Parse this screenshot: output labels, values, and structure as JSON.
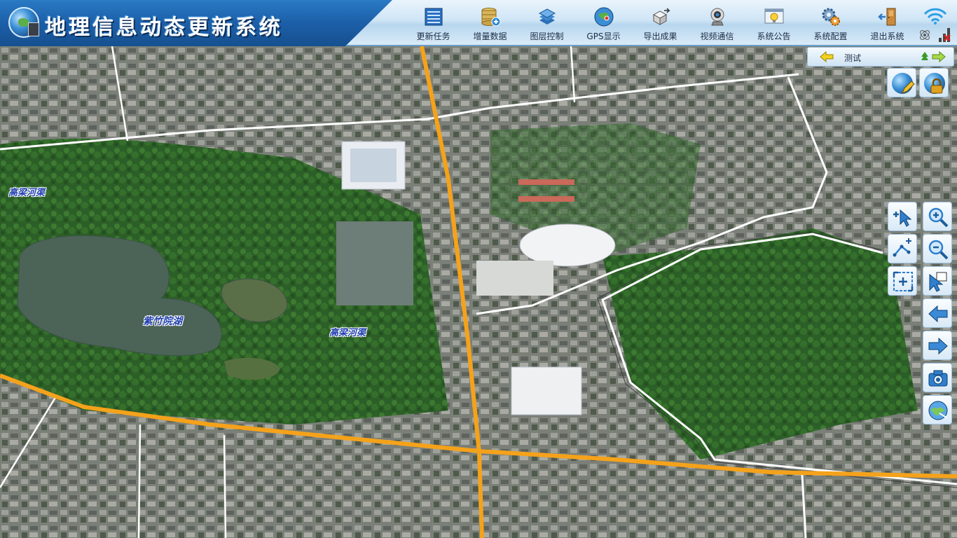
{
  "app": {
    "title": "地理信息动态更新系统"
  },
  "toolbar": {
    "items": [
      {
        "label": "更新任务",
        "icon": "task-list-icon"
      },
      {
        "label": "增量数据",
        "icon": "database-add-icon"
      },
      {
        "label": "图层控制",
        "icon": "layers-icon"
      },
      {
        "label": "GPS显示",
        "icon": "gps-globe-icon"
      },
      {
        "label": "导出成果",
        "icon": "export-box-icon"
      },
      {
        "label": "视频通信",
        "icon": "webcam-icon"
      },
      {
        "label": "系统公告",
        "icon": "announcement-bulb-icon"
      },
      {
        "label": "系统配置",
        "icon": "gear-config-icon"
      },
      {
        "label": "退出系统",
        "icon": "exit-door-icon"
      }
    ]
  },
  "status": {
    "icons": [
      "wifi-icon",
      "satellite-icon",
      "signal-bars-icon"
    ]
  },
  "layer_bar": {
    "label": "测试"
  },
  "map": {
    "labels": {
      "canal_west": "高梁河渠",
      "lake": "紫竹院湖",
      "canal_center": "高梁河渠"
    }
  },
  "map_tools": [
    {
      "name": "pan-add-tool",
      "icon": "pointer-plus-icon"
    },
    {
      "name": "zoom-in-tool",
      "icon": "zoom-in-icon"
    },
    {
      "name": "measure-tool",
      "icon": "measure-line-icon"
    },
    {
      "name": "zoom-out-tool",
      "icon": "zoom-out-icon"
    },
    {
      "name": "full-extent-tool",
      "icon": "full-extent-icon"
    },
    {
      "name": "select-tool",
      "icon": "pointer-select-icon"
    },
    {
      "name": "previous-view-tool",
      "icon": "arrow-left-icon"
    },
    {
      "name": "next-view-tool",
      "icon": "arrow-right-icon"
    },
    {
      "name": "screenshot-tool",
      "icon": "camera-icon"
    },
    {
      "name": "globe-view-tool",
      "icon": "globe-icon"
    }
  ],
  "colors": {
    "header_blue": "#1c5fa8",
    "road_orange": "#f5a21b",
    "road_white": "#ffffff",
    "vegetation": "#2f6b2a",
    "water": "#4c6458"
  }
}
